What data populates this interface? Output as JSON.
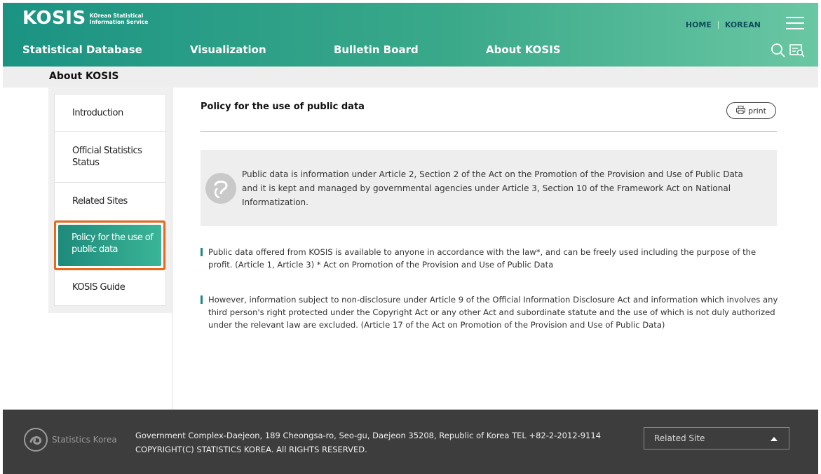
{
  "header": {
    "logo_main": "KOSIS",
    "logo_sub_line1": "KOrean Statistical",
    "logo_sub_line2": "Information Service",
    "util_home": "HOME",
    "util_korean": "KOREAN",
    "nav": [
      {
        "label": "Statistical Database"
      },
      {
        "label": "Visualization"
      },
      {
        "label": "Bulletin Board"
      },
      {
        "label": "About KOSIS"
      }
    ]
  },
  "subbar": {
    "title": "About KOSIS"
  },
  "sidebar": {
    "items": [
      {
        "label": "Introduction"
      },
      {
        "label": "Official Statistics Status"
      },
      {
        "label": "Related Sites"
      },
      {
        "label": "Policy for the use of public data"
      },
      {
        "label": "KOSIS Guide"
      }
    ]
  },
  "content": {
    "title": "Policy for the use of public data",
    "print_label": "print",
    "notice": "Public data is information under Article 2, Section 2 of the Act on the Promotion of the Provision and Use of Public Data and it is kept and managed by governmental agencies under Article 3, Section 10 of the Framework Act on National Informatization.",
    "paragraph1": "Public data offered from KOSIS is available to anyone in accordance with the law*, and can be freely used including the purpose of the profit. (Article 1, Article 3) * Act on Promotion of the Provision and Use of Public Data",
    "paragraph2": "However, information subject to non-disclosure under Article 9 of the Official Information Disclosure Act and information which involves any third person's right protected under the Copyright Act or any other Act and subordinate statute and the use of which is not duly authorized under the relevant law are excluded. (Article 17 of the Act on Promotion of the Provision and Use of Public Data)"
  },
  "footer": {
    "logo_text": "Statistics Korea",
    "address": "Government Complex-Daejeon, 189 Cheongsa-ro, Seo-gu, Daejeon 35208, Republic of Korea TEL +82-2-2012-9114",
    "copyright": "COPYRIGHT(C) STATISTICS KOREA. All RIGHTS RESERVED.",
    "related_site_label": "Related Site"
  },
  "colors": {
    "header_gradient_start": "#1b9383",
    "header_gradient_end": "#6ac7a3",
    "active_highlight": "#e8681c",
    "active_menu": "#1e8a7b",
    "footer_bg": "#3d3d3d"
  },
  "icons": [
    "hamburger-menu-icon",
    "search-icon",
    "statistics-search-icon",
    "print-icon",
    "notice-icon",
    "statistics-korea-logo-icon",
    "triangle-up-icon"
  ]
}
